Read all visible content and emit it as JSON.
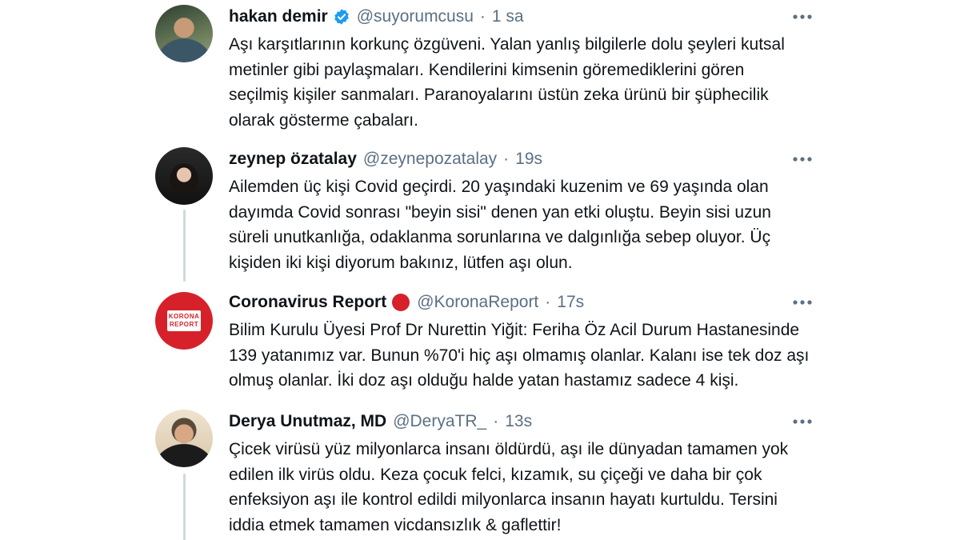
{
  "tweets": [
    {
      "name": "hakan demir",
      "handle": "@suyorumcusu",
      "separator": "·",
      "time": "1 sa",
      "verified": true,
      "avatar_icon": "user-photo",
      "text": "Aşı karşıtlarının korkunç özgüveni. Yalan yanlış bilgilerle dolu şeyleri kutsal\nmetinler gibi paylaşmaları. Kendilerini kimsenin göremediklerini gören\nseçilmiş kişiler sanmaları. Paranoyalarını üstün zeka ürünü bir şüphecilik\nolarak gösterme çabaları."
    },
    {
      "name": "zeynep özatalay",
      "handle": "@zeynepozatalay",
      "separator": "·",
      "time": "19s",
      "avatar_icon": "user-photo",
      "text": "Ailemden üç kişi Covid geçirdi. 20 yaşındaki kuzenim ve 69 yaşında olan\ndayımda Covid sonrası \"beyin sisi\" denen yan etki oluştu. Beyin sisi uzun\nsüreli unutkanlığa, odaklanma sorunlarına ve dalgınlığa sebep oluyor. Üç\nkişiden iki kişi diyorum bakınız, lütfen aşı olun."
    },
    {
      "name": "Coronavirus Report",
      "handle": "@KoronaReport",
      "separator": "·",
      "time": "17s",
      "avatar_logo_top": "KORONA",
      "avatar_logo_bottom": "REPORT",
      "text": "Bilim Kurulu Üyesi Prof Dr Nurettin Yiğit: Feriha Öz Acil Durum Hastanesinde\n139 yatanımız var. Bunun %70'i hiç aşı olmamış olanlar. Kalanı ise tek doz aşı\nolmuş olanlar. İki doz aşı olduğu halde yatan hastamız sadece 4 kişi."
    },
    {
      "name": "Derya Unutmaz, MD",
      "handle": "@DeryaTR_",
      "separator": "·",
      "time": "13s",
      "avatar_icon": "user-photo",
      "text": "Çicek virüsü yüz milyonlarca insanı öldürdü, aşı ile dünyadan tamamen yok\nedilen ilk virüs oldu. Keza çocuk felci, kızamık, su çiçeği ve daha bir çok\nenfeksiyon aşı ile kontrol edildi milyonlarca insanın hayatı kurtuldu. Tersini\niddia etmek tamamen vicdansızlık & gaflettir!"
    }
  ],
  "colors": {
    "verified": "#1d9bf0",
    "red_dot": "#d7212a",
    "secondary_text": "#5b7083",
    "thread_line": "#cfd9de"
  }
}
